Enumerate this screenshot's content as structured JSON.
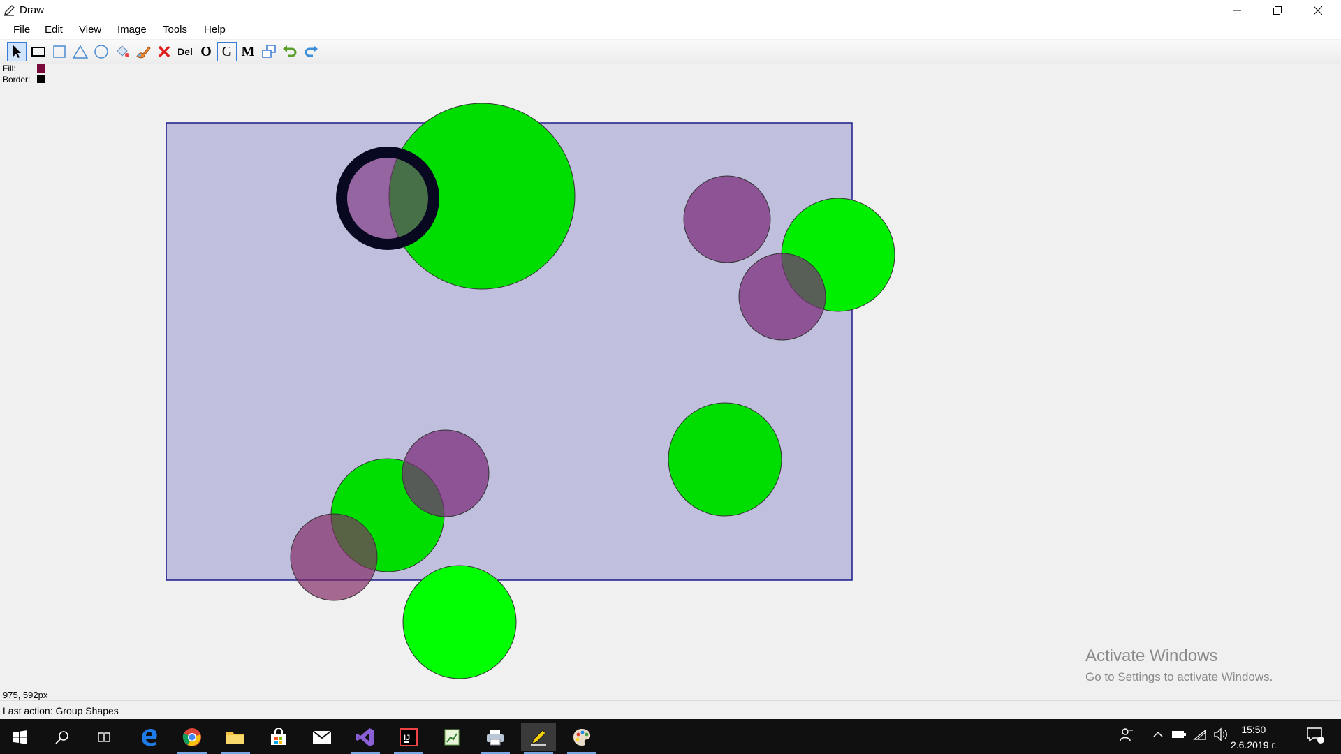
{
  "window": {
    "title": "Draw"
  },
  "menu": [
    "File",
    "Edit",
    "View",
    "Image",
    "Tools",
    "Help"
  ],
  "toolbar": {
    "tools": [
      "select-arrow",
      "rectangle",
      "square",
      "triangle",
      "ellipse",
      "fill",
      "brush",
      "delete-x",
      "Del",
      "O",
      "G",
      "M",
      "copy",
      "undo",
      "redo"
    ],
    "del_label": "Del",
    "o_label": "O",
    "g_label": "G",
    "m_label": "M"
  },
  "properties": {
    "fill_label": "Fill:",
    "fill_color": "#7a0a3a",
    "border_label": "Border:",
    "border_color": "#000000"
  },
  "status": {
    "coords": "975, 592px",
    "last_action": "Last action: Group Shapes"
  },
  "watermark": {
    "heading": "Activate Windows",
    "sub": "Go to Settings to activate Windows."
  },
  "clock": {
    "time": "15:50",
    "date": "2.6.2019 г."
  },
  "colors": {
    "group_rect": "#c0c0de",
    "green": "#00dd00",
    "bright_green": "#00ff00",
    "purple": "#8e4f8e"
  }
}
